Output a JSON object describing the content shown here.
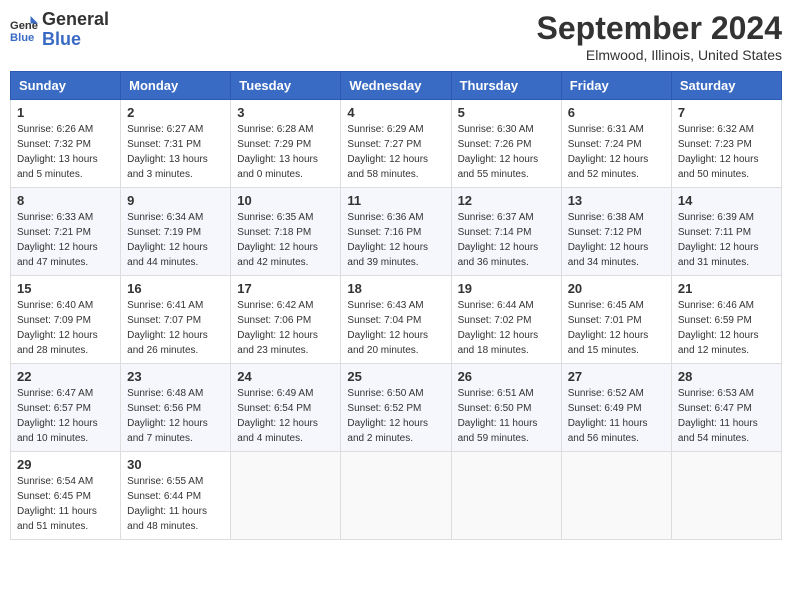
{
  "header": {
    "logo_line1": "General",
    "logo_line2": "Blue",
    "title": "September 2024",
    "subtitle": "Elmwood, Illinois, United States"
  },
  "days_of_week": [
    "Sunday",
    "Monday",
    "Tuesday",
    "Wednesday",
    "Thursday",
    "Friday",
    "Saturday"
  ],
  "weeks": [
    [
      {
        "day": "1",
        "info": "Sunrise: 6:26 AM\nSunset: 7:32 PM\nDaylight: 13 hours and 5 minutes."
      },
      {
        "day": "2",
        "info": "Sunrise: 6:27 AM\nSunset: 7:31 PM\nDaylight: 13 hours and 3 minutes."
      },
      {
        "day": "3",
        "info": "Sunrise: 6:28 AM\nSunset: 7:29 PM\nDaylight: 13 hours and 0 minutes."
      },
      {
        "day": "4",
        "info": "Sunrise: 6:29 AM\nSunset: 7:27 PM\nDaylight: 12 hours and 58 minutes."
      },
      {
        "day": "5",
        "info": "Sunrise: 6:30 AM\nSunset: 7:26 PM\nDaylight: 12 hours and 55 minutes."
      },
      {
        "day": "6",
        "info": "Sunrise: 6:31 AM\nSunset: 7:24 PM\nDaylight: 12 hours and 52 minutes."
      },
      {
        "day": "7",
        "info": "Sunrise: 6:32 AM\nSunset: 7:23 PM\nDaylight: 12 hours and 50 minutes."
      }
    ],
    [
      {
        "day": "8",
        "info": "Sunrise: 6:33 AM\nSunset: 7:21 PM\nDaylight: 12 hours and 47 minutes."
      },
      {
        "day": "9",
        "info": "Sunrise: 6:34 AM\nSunset: 7:19 PM\nDaylight: 12 hours and 44 minutes."
      },
      {
        "day": "10",
        "info": "Sunrise: 6:35 AM\nSunset: 7:18 PM\nDaylight: 12 hours and 42 minutes."
      },
      {
        "day": "11",
        "info": "Sunrise: 6:36 AM\nSunset: 7:16 PM\nDaylight: 12 hours and 39 minutes."
      },
      {
        "day": "12",
        "info": "Sunrise: 6:37 AM\nSunset: 7:14 PM\nDaylight: 12 hours and 36 minutes."
      },
      {
        "day": "13",
        "info": "Sunrise: 6:38 AM\nSunset: 7:12 PM\nDaylight: 12 hours and 34 minutes."
      },
      {
        "day": "14",
        "info": "Sunrise: 6:39 AM\nSunset: 7:11 PM\nDaylight: 12 hours and 31 minutes."
      }
    ],
    [
      {
        "day": "15",
        "info": "Sunrise: 6:40 AM\nSunset: 7:09 PM\nDaylight: 12 hours and 28 minutes."
      },
      {
        "day": "16",
        "info": "Sunrise: 6:41 AM\nSunset: 7:07 PM\nDaylight: 12 hours and 26 minutes."
      },
      {
        "day": "17",
        "info": "Sunrise: 6:42 AM\nSunset: 7:06 PM\nDaylight: 12 hours and 23 minutes."
      },
      {
        "day": "18",
        "info": "Sunrise: 6:43 AM\nSunset: 7:04 PM\nDaylight: 12 hours and 20 minutes."
      },
      {
        "day": "19",
        "info": "Sunrise: 6:44 AM\nSunset: 7:02 PM\nDaylight: 12 hours and 18 minutes."
      },
      {
        "day": "20",
        "info": "Sunrise: 6:45 AM\nSunset: 7:01 PM\nDaylight: 12 hours and 15 minutes."
      },
      {
        "day": "21",
        "info": "Sunrise: 6:46 AM\nSunset: 6:59 PM\nDaylight: 12 hours and 12 minutes."
      }
    ],
    [
      {
        "day": "22",
        "info": "Sunrise: 6:47 AM\nSunset: 6:57 PM\nDaylight: 12 hours and 10 minutes."
      },
      {
        "day": "23",
        "info": "Sunrise: 6:48 AM\nSunset: 6:56 PM\nDaylight: 12 hours and 7 minutes."
      },
      {
        "day": "24",
        "info": "Sunrise: 6:49 AM\nSunset: 6:54 PM\nDaylight: 12 hours and 4 minutes."
      },
      {
        "day": "25",
        "info": "Sunrise: 6:50 AM\nSunset: 6:52 PM\nDaylight: 12 hours and 2 minutes."
      },
      {
        "day": "26",
        "info": "Sunrise: 6:51 AM\nSunset: 6:50 PM\nDaylight: 11 hours and 59 minutes."
      },
      {
        "day": "27",
        "info": "Sunrise: 6:52 AM\nSunset: 6:49 PM\nDaylight: 11 hours and 56 minutes."
      },
      {
        "day": "28",
        "info": "Sunrise: 6:53 AM\nSunset: 6:47 PM\nDaylight: 11 hours and 54 minutes."
      }
    ],
    [
      {
        "day": "29",
        "info": "Sunrise: 6:54 AM\nSunset: 6:45 PM\nDaylight: 11 hours and 51 minutes."
      },
      {
        "day": "30",
        "info": "Sunrise: 6:55 AM\nSunset: 6:44 PM\nDaylight: 11 hours and 48 minutes."
      },
      {
        "day": "",
        "info": ""
      },
      {
        "day": "",
        "info": ""
      },
      {
        "day": "",
        "info": ""
      },
      {
        "day": "",
        "info": ""
      },
      {
        "day": "",
        "info": ""
      }
    ]
  ]
}
